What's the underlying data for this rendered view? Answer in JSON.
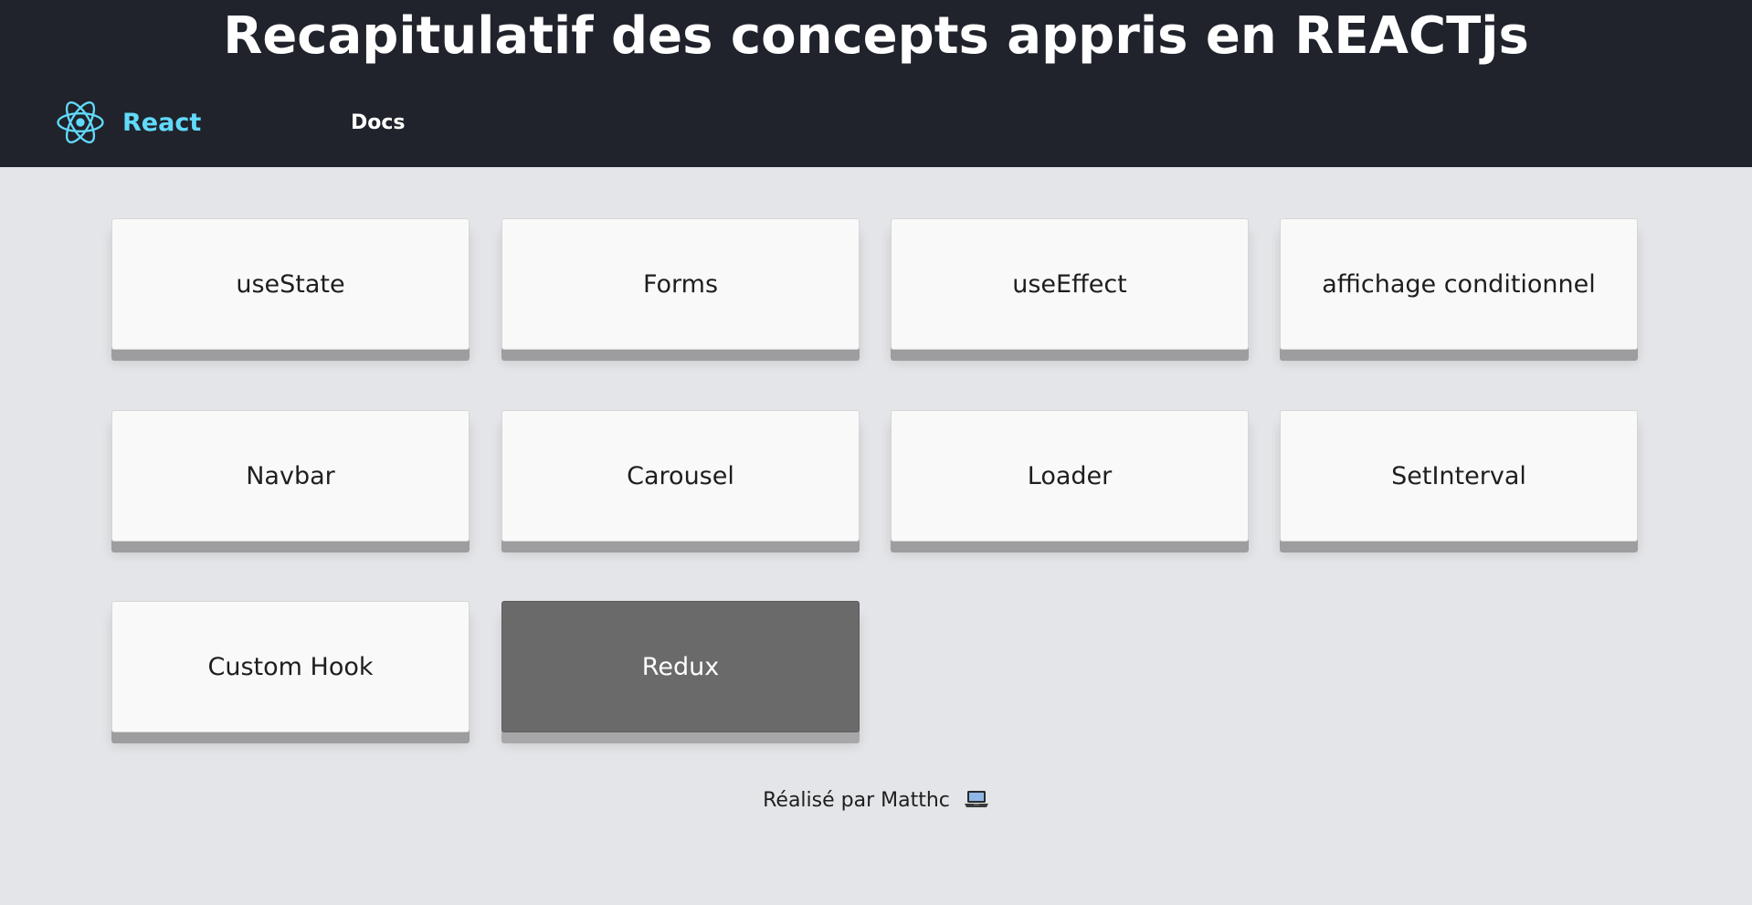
{
  "header": {
    "title": "Recapitulatif des concepts appris en REACTjs",
    "brand": {
      "name": "React",
      "icon": "react-atom-icon",
      "color": "#61dafb"
    },
    "nav": [
      {
        "label": "Docs"
      }
    ]
  },
  "cards": [
    {
      "label": "useState"
    },
    {
      "label": "Forms"
    },
    {
      "label": "useEffect"
    },
    {
      "label": "affichage conditionnel"
    },
    {
      "label": "Navbar"
    },
    {
      "label": "Carousel"
    },
    {
      "label": "Loader"
    },
    {
      "label": "SetInterval"
    },
    {
      "label": "Custom Hook"
    },
    {
      "label": "Redux",
      "active": true
    }
  ],
  "footer": {
    "text": "Réalisé par Matthc",
    "icon": "laptop-icon"
  },
  "colors": {
    "header_bg": "#20232b",
    "page_bg": "#e4e5e8",
    "card_bg": "#f9f9f9",
    "card_active_bg": "#6a6a6a",
    "accent": "#61dafb"
  }
}
